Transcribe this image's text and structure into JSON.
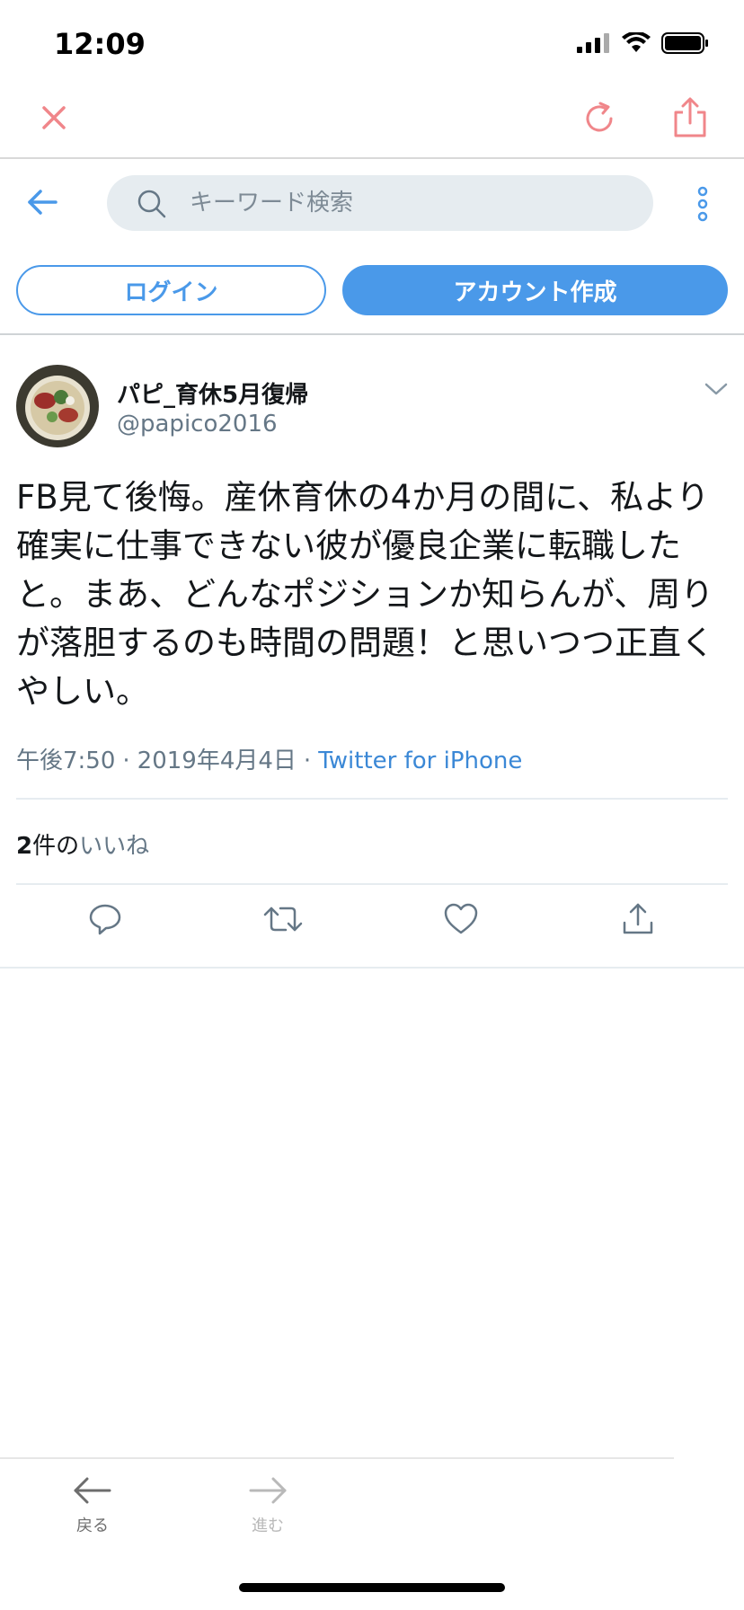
{
  "status": {
    "time": "12:09"
  },
  "search": {
    "placeholder": "キーワード検索"
  },
  "auth": {
    "login_label": "ログイン",
    "signup_label": "アカウント作成"
  },
  "tweet": {
    "display_name": "パピ_育休5月復帰",
    "handle": "@papico2016",
    "text": "FB見て後悔。産休育休の4か月の間に、私より確実に仕事できない彼が優良企業に転職したと。まあ、どんなポジションか知らんが、周りが落胆するのも時間の問題！と思いつつ正直くやしい。",
    "time": "午後7:50",
    "date": "2019年4月4日",
    "separator": "·",
    "source": "Twitter for iPhone",
    "likes_count": "2",
    "likes_unit": "件の",
    "likes_label": "いいね"
  },
  "toolbar": {
    "back_label": "戻る",
    "forward_label": "進む"
  },
  "colors": {
    "accent": "#4a99e9",
    "browser_icon": "#f0868a",
    "secondary_text": "#657786"
  },
  "icons": [
    "close-icon",
    "reload-icon",
    "share-icon",
    "back-arrow-icon",
    "search-icon",
    "more-icon",
    "chevron-down-icon",
    "reply-icon",
    "retweet-icon",
    "like-icon",
    "share-tweet-icon",
    "arrow-left-icon",
    "arrow-right-icon"
  ]
}
